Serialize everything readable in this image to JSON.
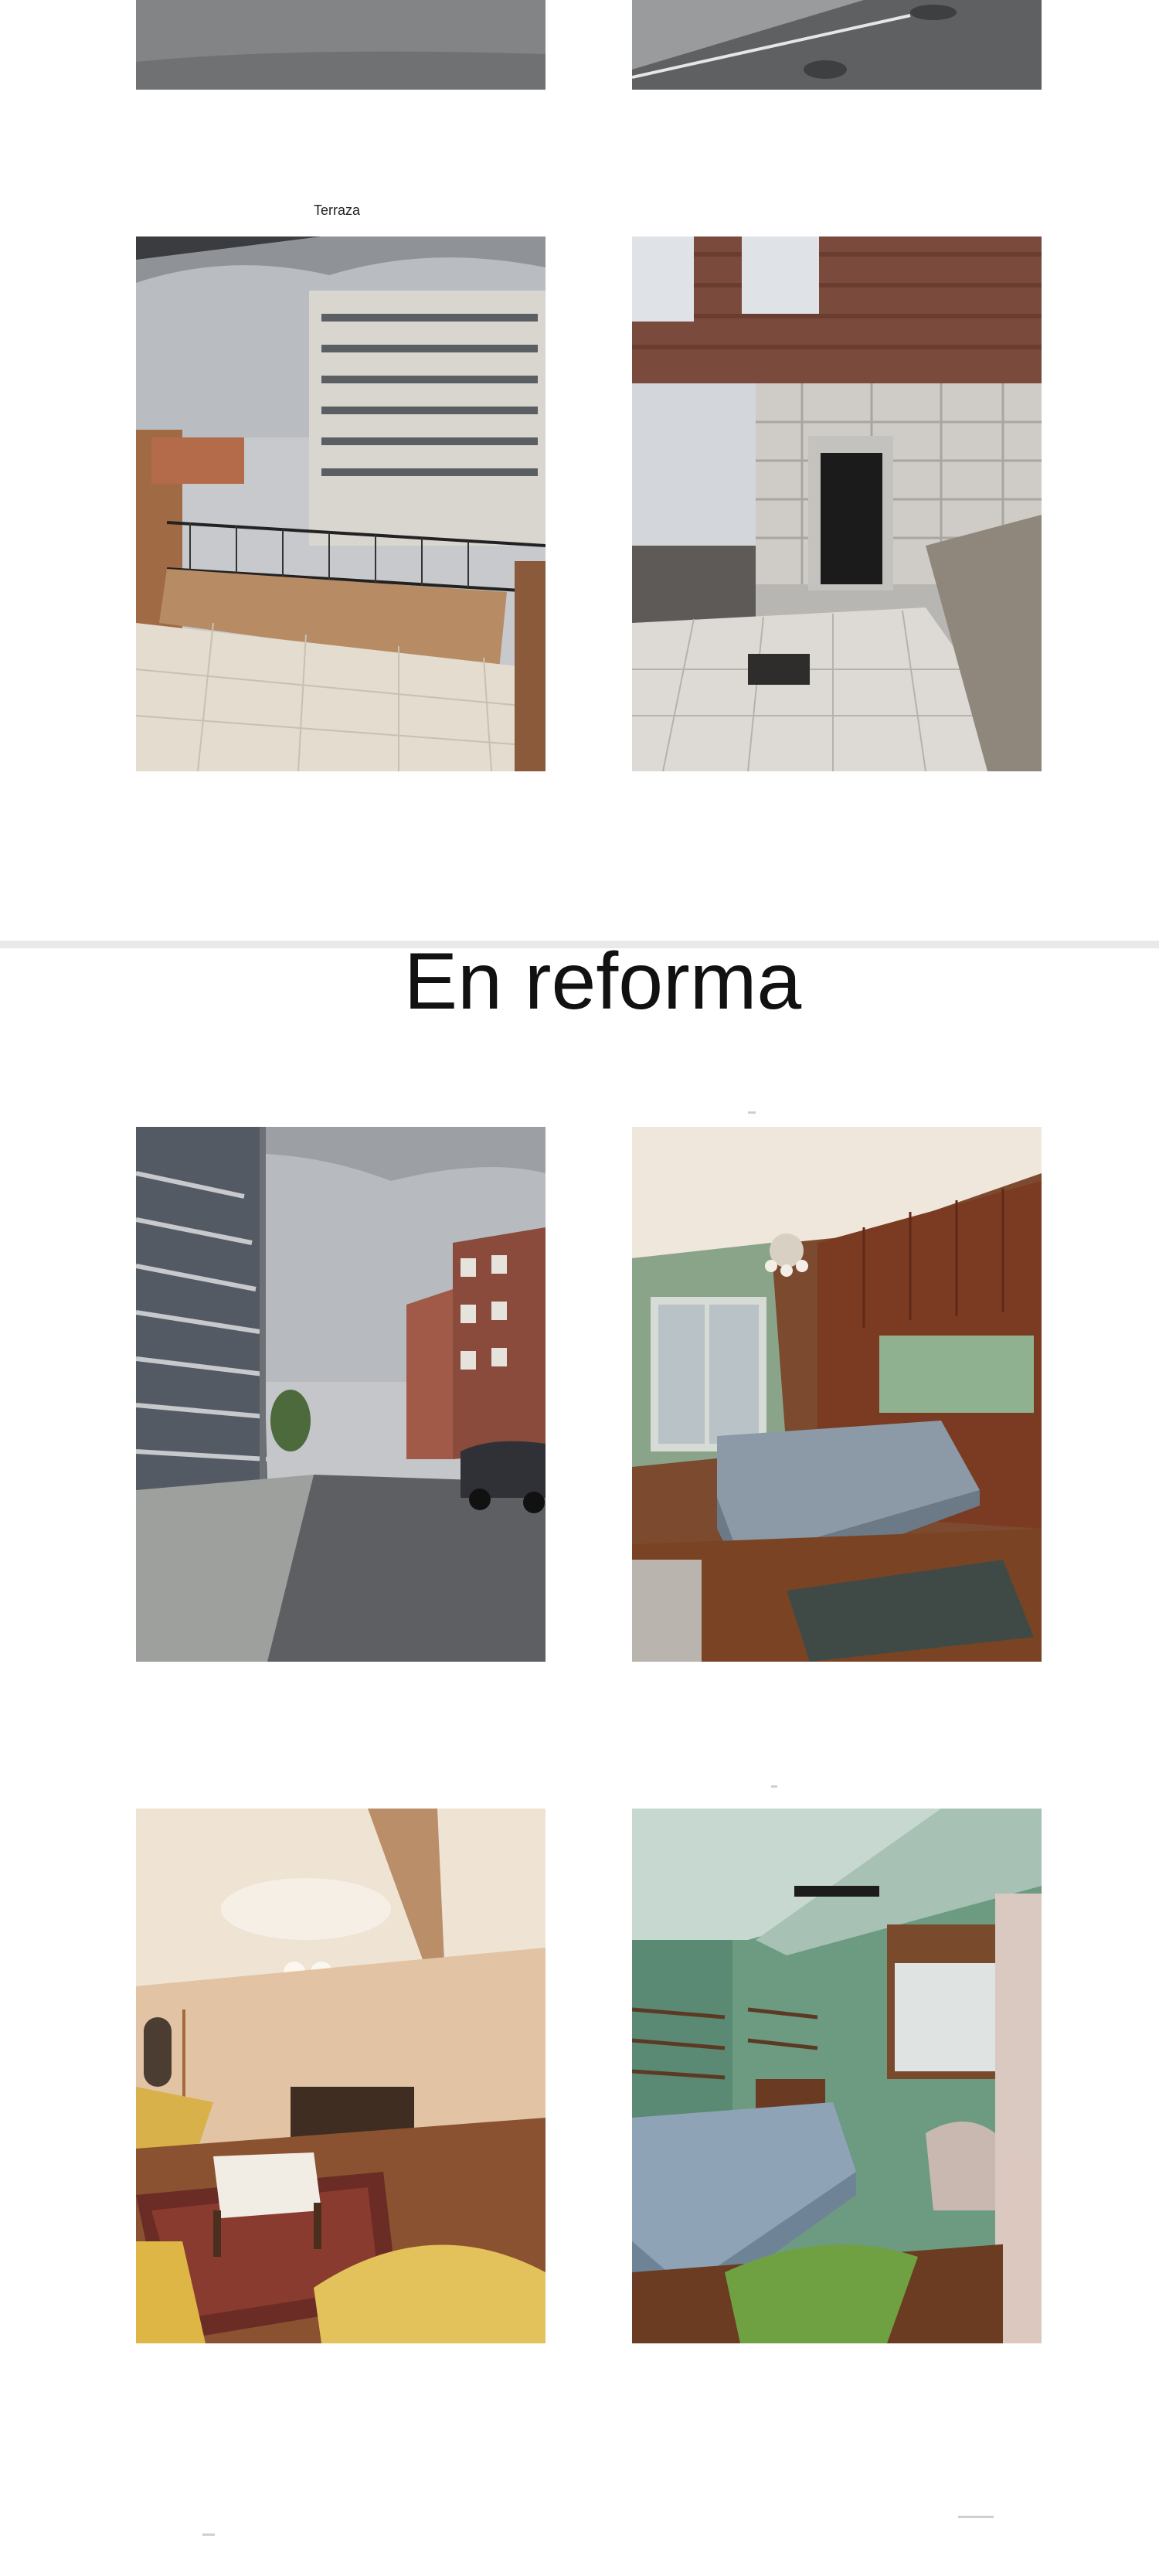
{
  "captions": {
    "terrace": "Terraza"
  },
  "section_heading": "En reforma",
  "colors": {
    "background": "#ffffff",
    "divider": "#e9e9e9",
    "heading": "#111111"
  },
  "photos": [
    {
      "id": "street-top-left",
      "subject": "asphalt street"
    },
    {
      "id": "street-top-right",
      "subject": "street with manhole"
    },
    {
      "id": "terrace-balcony",
      "subject": "balcony terrace view of buildings"
    },
    {
      "id": "building-entrance",
      "subject": "building entrance with stone facade"
    },
    {
      "id": "street-view",
      "subject": "street between apartment buildings"
    },
    {
      "id": "bedroom-wood",
      "subject": "bedroom with wooden wardrobe"
    },
    {
      "id": "living-room",
      "subject": "living room with chandelier"
    },
    {
      "id": "bedroom-green",
      "subject": "green bedroom with window"
    }
  ]
}
